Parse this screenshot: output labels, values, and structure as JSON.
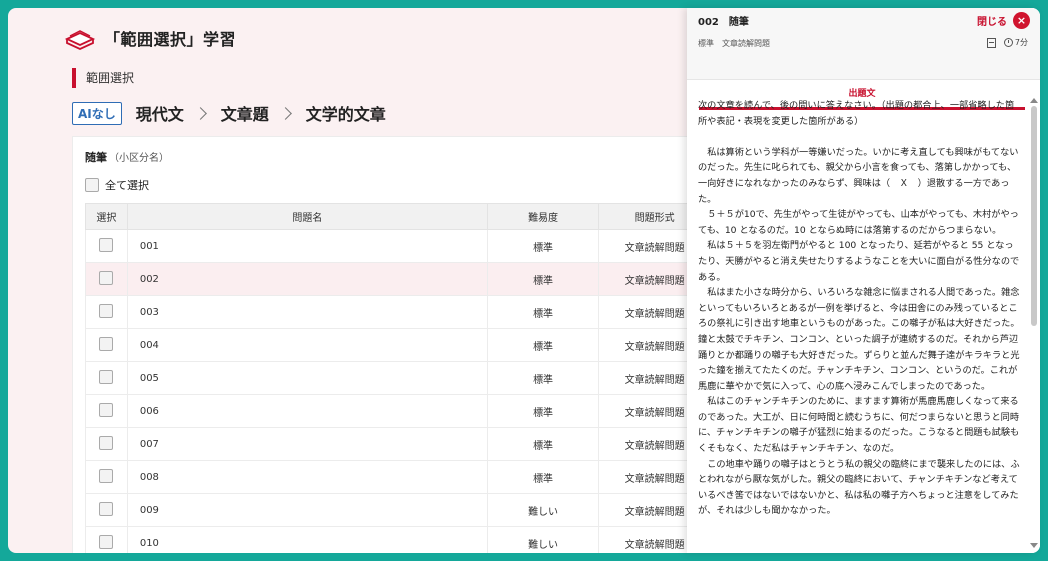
{
  "header": {
    "title": "「範囲選択」学習",
    "section_label": "範囲選択",
    "ai_badge": "AIなし",
    "breadcrumbs": [
      "現代文",
      "文章題",
      "文学的文章"
    ]
  },
  "card": {
    "title": "随筆",
    "subtitle": "（小区分名）",
    "select_all_label": "全て選択",
    "columns": [
      "選択",
      "問題名",
      "難易度",
      "問題形式"
    ],
    "rows": [
      {
        "name": "001",
        "difficulty": "標準",
        "format": "文章読解問題"
      },
      {
        "name": "002",
        "difficulty": "標準",
        "format": "文章読解問題"
      },
      {
        "name": "003",
        "difficulty": "標準",
        "format": "文章読解問題"
      },
      {
        "name": "004",
        "difficulty": "標準",
        "format": "文章読解問題"
      },
      {
        "name": "005",
        "difficulty": "標準",
        "format": "文章読解問題"
      },
      {
        "name": "006",
        "difficulty": "標準",
        "format": "文章読解問題"
      },
      {
        "name": "007",
        "difficulty": "標準",
        "format": "文章読解問題"
      },
      {
        "name": "008",
        "difficulty": "標準",
        "format": "文章読解問題"
      },
      {
        "name": "009",
        "difficulty": "難しい",
        "format": "文章読解問題"
      },
      {
        "name": "010",
        "difficulty": "難しい",
        "format": "文章読解問題"
      }
    ],
    "highlighted_row": "002"
  },
  "drawer": {
    "title": "002　随筆",
    "subtitle": "標準　文章読解問題",
    "close_label": "閉じる",
    "time": "7分",
    "tab_label": "出題文",
    "lead": "次の文章を読んで、後の問いに答えなさい。（出題の都合上、一部省略した箇所や表記・表現を変更した箇所がある）",
    "paragraphs": [
      "私は算術という学科が一等嫌いだった。いかに考え直しても興味がもてないのだった。先生に叱られても、親父から小言を食っても、落第しかかっても、一向好きになれなかったのみならず、興味は（　Ｘ　）退散する一方であった。",
      "５＋５が10で、先生がやって生徒がやっても、山本がやっても、木村がやっても、10 となるのだ。10 とならぬ時には落第するのだからつまらない。",
      "私は５＋５を羽左衛門がやると 100 となったり、延若がやると 55 となったり、天勝がやると消え失せたりするようなことを大いに面白がる性分なのである。",
      "私はまた小さな時分から、いろいろな雑念に悩まされる人間であった。雑念といってもいろいろとあるが一例を挙げると、今は田舎にのみ残っているところの祭礼に引き出す地車というものがあった。この囃子が私は大好きだった。鐘と太鼓でチキチン、コンコン、といった調子が連続するのだ。それから芦辺踊りとか都踊りの囃子も大好きだった。ずらりと並んだ舞子達がキラキラと光った鐘を揃えてたたくのだ。チャンチキチン、コンコン、というのだ。これが馬鹿に華やかで気に入って、心の底へ浸みこんでしまったのであった。",
      "私はこのチャンチキチンのために、ますます算術が馬鹿馬鹿しくなって来るのであった。大工が、日に何時間と読むうちに、何だつまらないと思うと同時に、チャンチキチンの囃子が猛烈に始まるのだった。こうなると問題も試験もくそもなく、ただ私はチャンチキチン、なのだ。",
      "この地車や踊りの囃子はとうとう私の親父の臨終にまで襲来したのには、ふとわれながら厭な気がした。親父の臨終において、チャンチキチンなど考えているべき筈ではないではないかと、私は私の囃子方へちょっと注意をしてみたが、それは少しも聞かなかった。"
    ]
  }
}
